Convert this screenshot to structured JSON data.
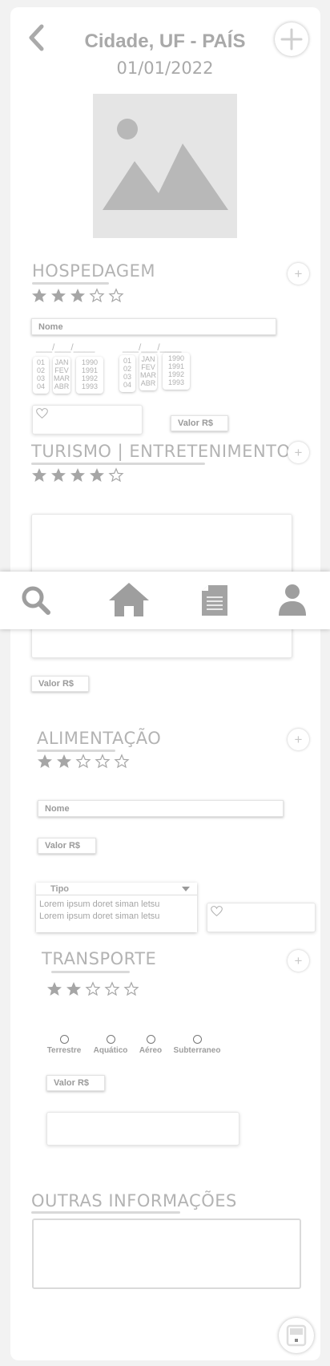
{
  "header": {
    "title": "Cidade, UF - PAÍS",
    "date": "01/01/2022"
  },
  "sections": {
    "hospedagem": {
      "title": "HOSPEDAGEM",
      "rating": 3,
      "name_placeholder": "Nome",
      "date_separator": "___/___/____",
      "days": [
        "01",
        "02",
        "03",
        "04"
      ],
      "months": [
        "JAN",
        "FEV",
        "MAR",
        "ABR"
      ],
      "years": [
        "1990",
        "1991",
        "1992",
        "1993"
      ],
      "value_label": "Valor R$"
    },
    "turismo": {
      "title": "TURISMO | ENTRETENIMENTO",
      "rating": 4,
      "value_label": "Valor R$"
    },
    "alimentacao": {
      "title": "ALIMENTAÇÃO",
      "rating": 2,
      "name_placeholder": "Nome",
      "value_label": "Valor R$",
      "type_label": "Tipo",
      "type_options": [
        "Lorem ipsum doret siman letsu",
        "Lorem ipsum doret siman letsu"
      ]
    },
    "transporte": {
      "title": "TRANSPORTE",
      "rating": 2,
      "options": [
        "Terrestre",
        "Aquático",
        "Aéreo",
        "Subterraneo"
      ],
      "value_label": "Valor R$"
    },
    "outras": {
      "title": "OUTRAS INFORMAÇÕES"
    }
  },
  "navbar": {
    "items": [
      "search-icon",
      "home-icon",
      "document-icon",
      "user-icon"
    ]
  },
  "colors": {
    "background": "#f2f2f2",
    "card": "#ffffff",
    "text": "#a5a5a5",
    "icon": "#9e9e9e"
  }
}
